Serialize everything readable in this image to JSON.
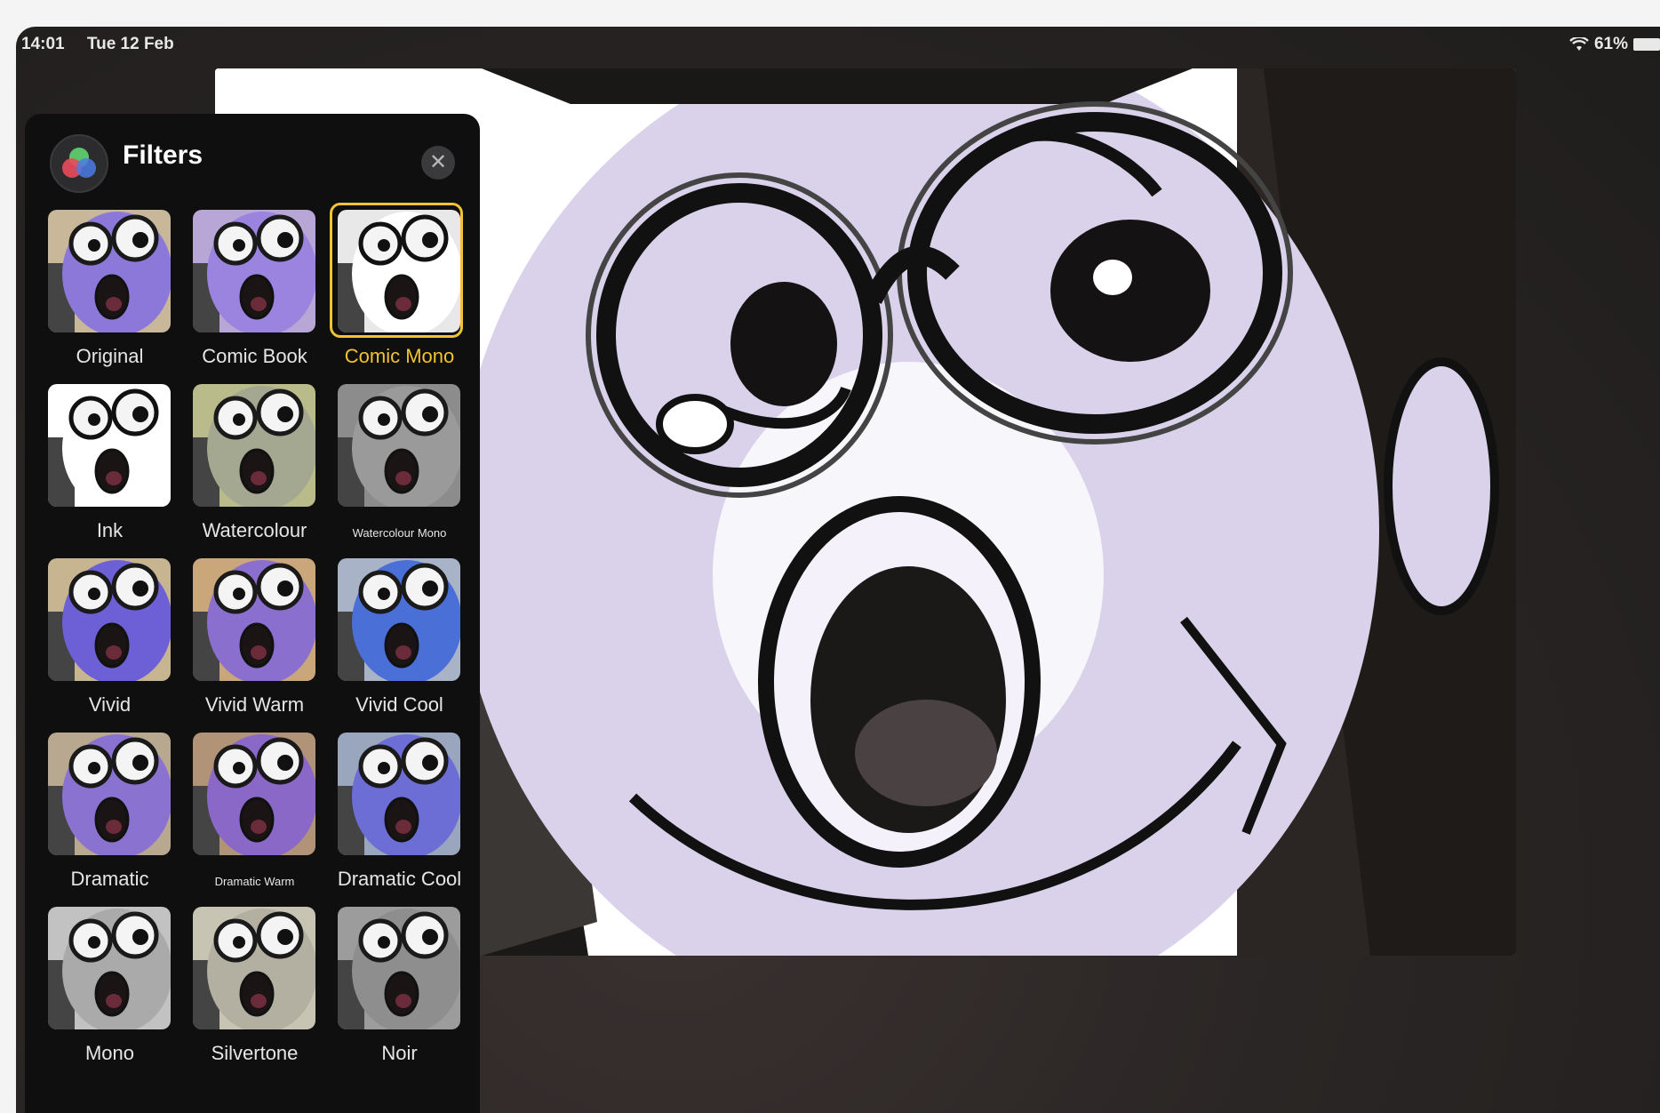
{
  "status_bar": {
    "time": "14:01",
    "date": "Tue 12 Feb",
    "battery": "61%"
  },
  "panel": {
    "title": "Filters",
    "close_icon": "close-icon",
    "selected": "Comic Mono",
    "filters": [
      {
        "label": "Original",
        "skin": "#8c78d8",
        "bg": "#c9b79a",
        "small": false
      },
      {
        "label": "Comic Book",
        "skin": "#9a84e0",
        "bg": "#b8a6d6",
        "small": false
      },
      {
        "label": "Comic Mono",
        "skin": "#ffffff",
        "bg": "#e8e8e8",
        "small": false,
        "selected": true
      },
      {
        "label": "Ink",
        "skin": "#ffffff",
        "bg": "#ffffff",
        "small": false
      },
      {
        "label": "Watercolour",
        "skin": "#a4a890",
        "bg": "#b9bb8a",
        "small": false
      },
      {
        "label": "Watercolour Mono",
        "skin": "#9a9a9a",
        "bg": "#8c8c8c",
        "small": true
      },
      {
        "label": "Vivid",
        "skin": "#6d5fd6",
        "bg": "#c7b592",
        "small": false
      },
      {
        "label": "Vivid Warm",
        "skin": "#8b6fcf",
        "bg": "#c9a77a",
        "small": false
      },
      {
        "label": "Vivid Cool",
        "skin": "#4a6fd6",
        "bg": "#a8b3c8",
        "small": false
      },
      {
        "label": "Dramatic",
        "skin": "#8a72d0",
        "bg": "#b8a890",
        "small": false
      },
      {
        "label": "Dramatic Warm",
        "skin": "#8a68c8",
        "bg": "#b19478",
        "small": true
      },
      {
        "label": "Dramatic Cool",
        "skin": "#6c6ed6",
        "bg": "#9aa6be",
        "small": false
      },
      {
        "label": "Mono",
        "skin": "#aaaaaa",
        "bg": "#c2c2c2",
        "small": false
      },
      {
        "label": "Silvertone",
        "skin": "#b3b0a2",
        "bg": "#c8c4b3",
        "small": false
      },
      {
        "label": "Noir",
        "skin": "#8e8e8e",
        "bg": "#9c9c9c",
        "small": false
      }
    ]
  },
  "colors": {
    "accent_selected": "#f1c232",
    "panel_bg": "#0f0f10",
    "photo_skin": "#d9d2ea"
  }
}
